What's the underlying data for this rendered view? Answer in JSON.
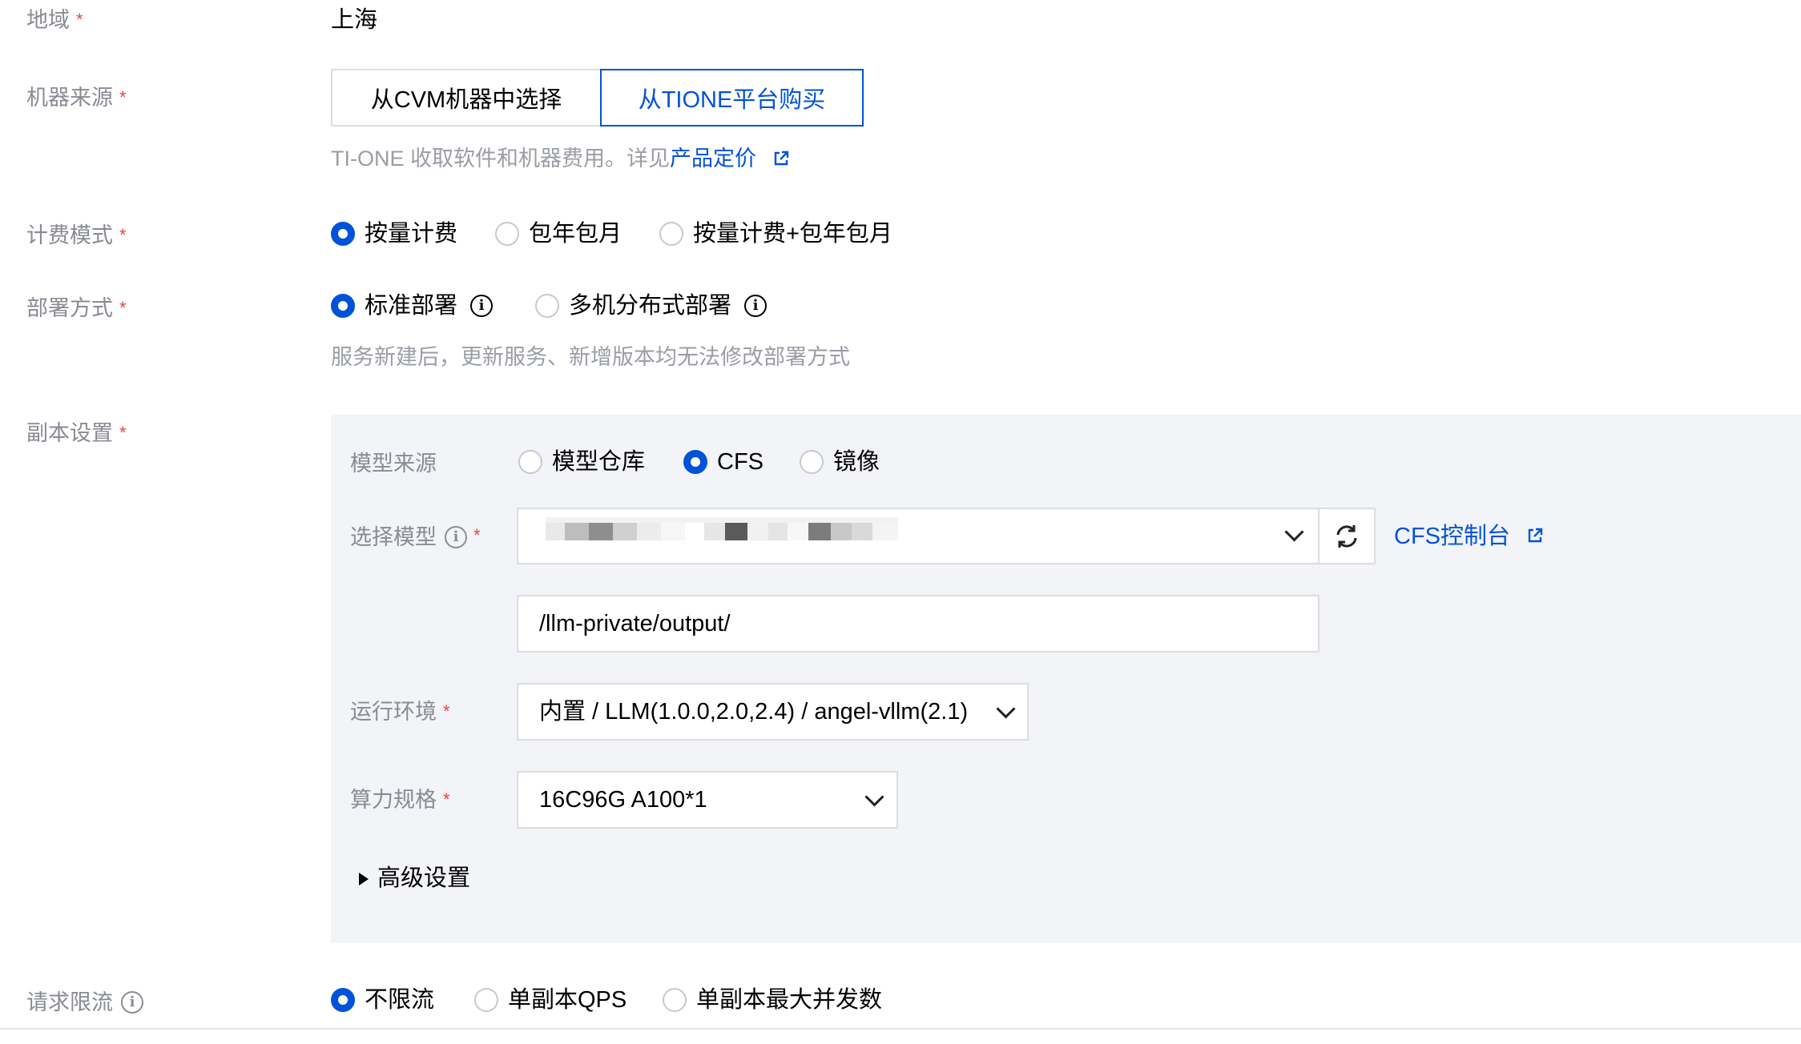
{
  "region": {
    "label": "地域",
    "value": "上海"
  },
  "machine_source": {
    "label": "机器来源",
    "option_cvm": "从CVM机器中选择",
    "option_tione": "从TIONE平台购买",
    "hint": "TI-ONE 收取软件和机器费用。详见",
    "hint_link": "产品定价"
  },
  "billing": {
    "label": "计费模式",
    "options": [
      "按量计费",
      "包年包月",
      "按量计费+包年包月"
    ],
    "selected": "按量计费"
  },
  "deploy": {
    "label": "部署方式",
    "options": [
      "标准部署",
      "多机分布式部署"
    ],
    "selected": "标准部署",
    "hint": "服务新建后，更新服务、新增版本均无法修改部署方式"
  },
  "replica": {
    "label": "副本设置",
    "model_source": {
      "label": "模型来源",
      "options": [
        "模型仓库",
        "CFS",
        "镜像"
      ],
      "selected": "CFS"
    },
    "select_model": {
      "label": "选择模型",
      "cfs_link": "CFS控制台"
    },
    "path": {
      "value": "/llm-private/output/"
    },
    "runtime": {
      "label": "运行环境",
      "value": "内置 / LLM(1.0.0,2.0,2.4) / angel-vllm(2.1)"
    },
    "compute": {
      "label": "算力规格",
      "value": "16C96G A100*1"
    },
    "advanced": {
      "label": "高级设置"
    }
  },
  "rate_limit": {
    "label": "请求限流",
    "options": [
      "不限流",
      "单副本QPS",
      "单副本最大并发数"
    ],
    "selected": "不限流"
  },
  "colors": {
    "accent": "#0052d9",
    "required": "#e54545",
    "panel_bg": "#f3f4f7"
  }
}
